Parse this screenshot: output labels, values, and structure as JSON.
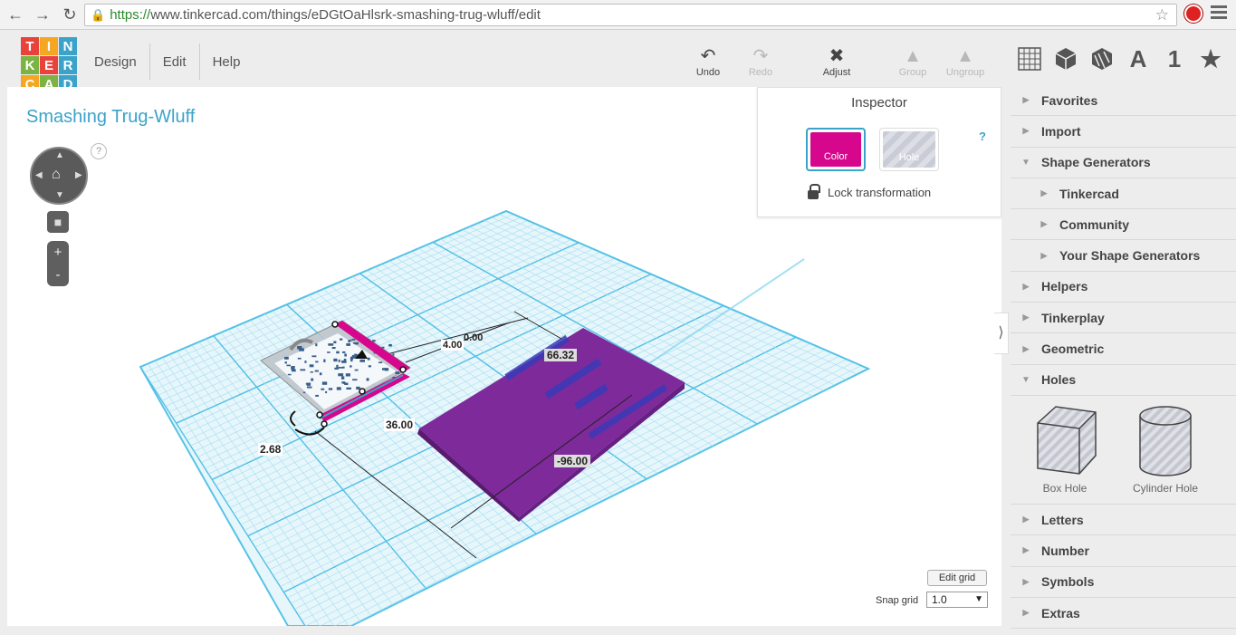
{
  "browser": {
    "url_https": "https://",
    "url_rest": "www.tinkercad.com/things/eDGtOaHlsrk-smashing-trug-wluff/edit"
  },
  "logo": {
    "letters": [
      "T",
      "I",
      "N",
      "K",
      "E",
      "R",
      "C",
      "A",
      "D"
    ],
    "colors": [
      "#e8423a",
      "#f5a623",
      "#3ba3c9",
      "#7cb342",
      "#e8423a",
      "#3ba3c9",
      "#f5a623",
      "#7cb342",
      "#3ba3c9"
    ]
  },
  "menu": {
    "design": "Design",
    "edit": "Edit",
    "help": "Help"
  },
  "toolbar": {
    "undo": "Undo",
    "redo": "Redo",
    "adjust": "Adjust",
    "group": "Group",
    "ungroup": "Ungroup"
  },
  "view_icons": {
    "letter": "A",
    "number": "1"
  },
  "design": {
    "title": "Smashing Trug-Wluff",
    "help": "?"
  },
  "inspector": {
    "title": "Inspector",
    "color_label": "Color",
    "hole_label": "Hole",
    "help": "?",
    "lock_label": "Lock transformation",
    "color_hex": "#d6078c"
  },
  "dimensions": {
    "d1": "0.00",
    "d2": "4.00",
    "d3": "66.32",
    "d4": "36.00",
    "d5": "2.68",
    "d6": "-96.00"
  },
  "grid": {
    "edit_label": "Edit grid",
    "snap_label": "Snap grid",
    "snap_value": "1.0"
  },
  "panel": {
    "items": [
      {
        "label": "Favorites",
        "open": false,
        "sub": false
      },
      {
        "label": "Import",
        "open": false,
        "sub": false
      },
      {
        "label": "Shape Generators",
        "open": true,
        "sub": false
      },
      {
        "label": "Tinkercad",
        "open": false,
        "sub": true
      },
      {
        "label": "Community",
        "open": false,
        "sub": true
      },
      {
        "label": "Your Shape Generators",
        "open": false,
        "sub": true
      },
      {
        "label": "Helpers",
        "open": false,
        "sub": false
      },
      {
        "label": "Tinkerplay",
        "open": false,
        "sub": false
      },
      {
        "label": "Geometric",
        "open": false,
        "sub": false
      },
      {
        "label": "Holes",
        "open": true,
        "sub": false
      }
    ],
    "holes": {
      "box": "Box Hole",
      "cylinder": "Cylinder Hole"
    },
    "after": [
      {
        "label": "Letters"
      },
      {
        "label": "Number"
      },
      {
        "label": "Symbols"
      },
      {
        "label": "Extras"
      }
    ]
  }
}
